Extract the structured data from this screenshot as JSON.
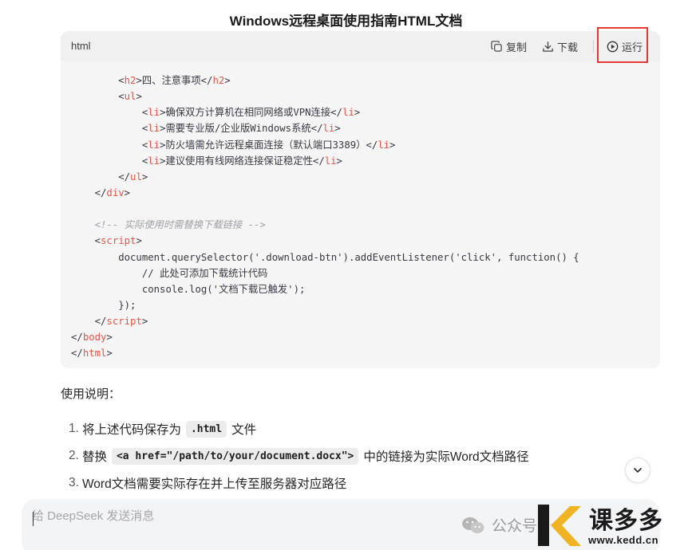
{
  "title": "Windows远程桌面使用指南HTML文档",
  "code_block": {
    "language": "html",
    "copy_label": "复制",
    "download_label": "下载",
    "run_label": "运行",
    "lines": [
      [
        {
          "t": "        "
        },
        {
          "t": "<",
          "c": "txt"
        },
        {
          "t": "h2",
          "c": "tag"
        },
        {
          "t": ">四、注意事项</"
        },
        {
          "t": "h2",
          "c": "tag"
        },
        {
          "t": ">"
        }
      ],
      [
        {
          "t": "        <"
        },
        {
          "t": "ul",
          "c": "tag"
        },
        {
          "t": ">"
        }
      ],
      [
        {
          "t": "            <"
        },
        {
          "t": "li",
          "c": "tag"
        },
        {
          "t": ">确保双方计算机在相同网络或VPN连接</"
        },
        {
          "t": "li",
          "c": "tag"
        },
        {
          "t": ">"
        }
      ],
      [
        {
          "t": "            <"
        },
        {
          "t": "li",
          "c": "tag"
        },
        {
          "t": ">需要专业版/企业版Windows系统</"
        },
        {
          "t": "li",
          "c": "tag"
        },
        {
          "t": ">"
        }
      ],
      [
        {
          "t": "            <"
        },
        {
          "t": "li",
          "c": "tag"
        },
        {
          "t": ">防火墙需允许远程桌面连接（默认端口3389）</"
        },
        {
          "t": "li",
          "c": "tag"
        },
        {
          "t": ">"
        }
      ],
      [
        {
          "t": "            <"
        },
        {
          "t": "li",
          "c": "tag"
        },
        {
          "t": ">建议使用有线网络连接保证稳定性</"
        },
        {
          "t": "li",
          "c": "tag"
        },
        {
          "t": ">"
        }
      ],
      [
        {
          "t": "        </"
        },
        {
          "t": "ul",
          "c": "tag"
        },
        {
          "t": ">"
        }
      ],
      [
        {
          "t": "    </"
        },
        {
          "t": "div",
          "c": "tag"
        },
        {
          "t": ">"
        }
      ],
      [
        {
          "t": ""
        }
      ],
      [
        {
          "t": "    "
        },
        {
          "t": "<!-- 实际使用时需替换下载链接 -->",
          "c": "cmt"
        }
      ],
      [
        {
          "t": "    <"
        },
        {
          "t": "script",
          "c": "tag"
        },
        {
          "t": ">"
        }
      ],
      [
        {
          "t": "        document.querySelector('.download-btn').addEventListener('click', function() {"
        }
      ],
      [
        {
          "t": "            // 此处可添加下载统计代码"
        }
      ],
      [
        {
          "t": "            console.log('文档下载已触发');"
        }
      ],
      [
        {
          "t": "        });"
        }
      ],
      [
        {
          "t": "    </"
        },
        {
          "t": "script",
          "c": "tag"
        },
        {
          "t": ">"
        }
      ],
      [
        {
          "t": "</"
        },
        {
          "t": "body",
          "c": "tag"
        },
        {
          "t": ">"
        }
      ],
      [
        {
          "t": "</"
        },
        {
          "t": "html",
          "c": "tag"
        },
        {
          "t": ">"
        }
      ]
    ]
  },
  "usage": {
    "heading": "使用说明：",
    "steps": [
      {
        "num": "1.",
        "before": "将上述代码保存为",
        "code": ".html",
        "after": "文件"
      },
      {
        "num": "2.",
        "before": "替换",
        "code": "<a href=\"/path/to/your/document.docx\">",
        "after": "中的链接为实际Word文档路径"
      },
      {
        "num": "3.",
        "before": "Word文档需要实际存在并上传至服务器对应路径",
        "code": "",
        "after": ""
      }
    ]
  },
  "composer": {
    "placeholder": "给 DeepSeek 发送消息"
  },
  "watermark": {
    "wechat_text": "公众号",
    "brand": "课多多",
    "domain": "www.kedd.cn"
  },
  "colors": {
    "tag": "#e45649",
    "comment": "#a0a1a7",
    "highlight_box": "#e53935",
    "code_bg": "#f5f5f5"
  },
  "icons": {
    "copy": "copy-icon",
    "download": "download-icon",
    "run": "play-circle-icon",
    "scroll": "chevron-down-icon"
  }
}
